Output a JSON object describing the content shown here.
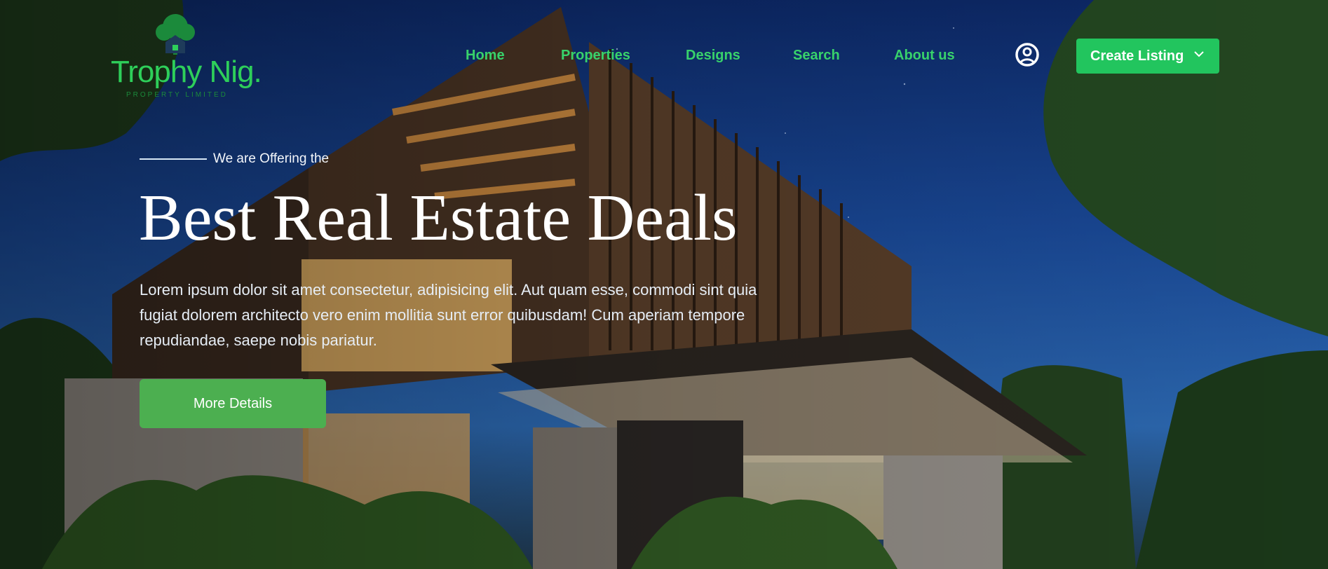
{
  "logo": {
    "name": "Trophy Nig.",
    "tagline": "PROPERTY LIMITED"
  },
  "nav": {
    "items": [
      {
        "label": "Home"
      },
      {
        "label": "Properties"
      },
      {
        "label": "Designs"
      },
      {
        "label": "Search"
      },
      {
        "label": "About us"
      }
    ],
    "user_icon": "user-circle-icon",
    "create_listing_label": "Create Listing",
    "create_listing_icon": "chevron-down-icon"
  },
  "hero": {
    "eyebrow": "We are Offering the",
    "headline": "Best Real Estate Deals",
    "description": "Lorem ipsum dolor sit amet consectetur, adipisicing elit. Aut quam esse, commodi sint quia fugiat dolorem architecto vero enim mollitia sunt error quibusdam! Cum aperiam tempore repudiandae, saepe nobis pariatur.",
    "cta_label": "More Details",
    "background": "modern-house-at-night-photo"
  },
  "colors": {
    "brand_green": "#22c55e",
    "nav_green": "#38d26b",
    "cta_green": "#4caf50"
  }
}
